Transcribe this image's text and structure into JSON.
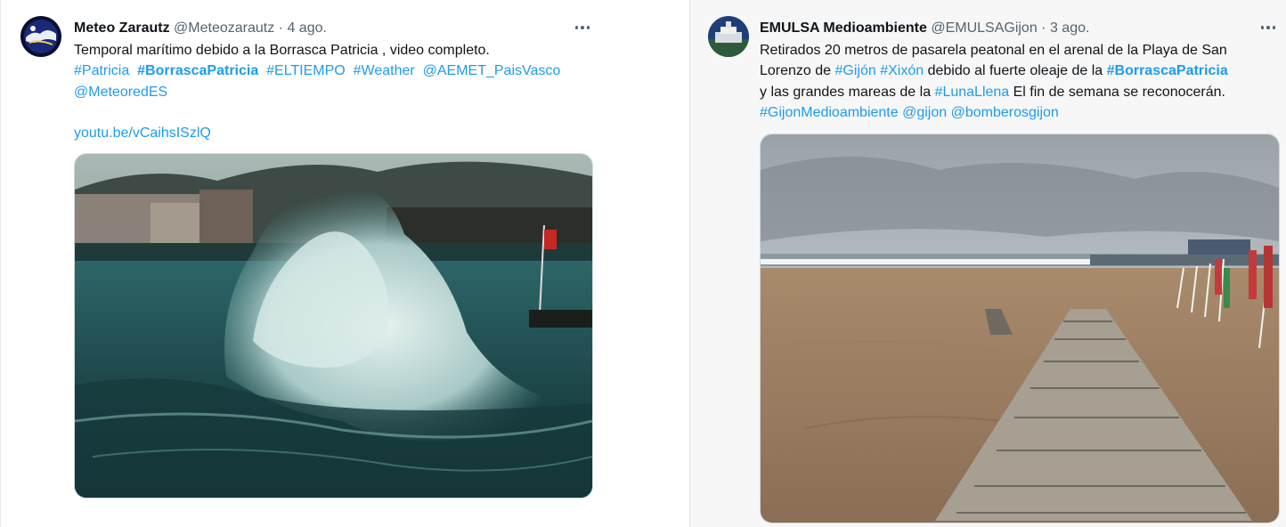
{
  "tweets": [
    {
      "name": "Meteo Zarautz",
      "handle": "@Meteozarautz",
      "separator": "·",
      "time": "4 ago.",
      "text_line1": "Temporal marítimo  debido a la Borrasca Patricia , video completo.",
      "hashtags": [
        "#Patricia",
        "#BorrascaPatricia",
        "#ELTIEMPO",
        "#Weather",
        "@AEMET_PaisVasco",
        "@MeteoredES"
      ],
      "link": "youtu.be/vCaihsISzlQ",
      "media_description_icon": "wave-crashing-photo"
    },
    {
      "name": "EMULSA Medioambiente",
      "handle": "@EMULSAGijon",
      "separator": "·",
      "time": "3 ago.",
      "line1": "Retirados 20 metros de pasarela peatonal en el arenal de la Playa de San",
      "line2_prefix": "Lorenzo de ",
      "tag_gijon": "#Gijón",
      "tag_xixon": "#Xixón",
      "line2_middle": " debido al fuerte oleaje de la ",
      "tag_borrasca": "#BorrascaPatricia",
      "line3_prefix": "y las grandes mareas de la ",
      "tag_luna": "#LunaLlena",
      "line3_suffix": " El fin de semana se reconocerán.",
      "tag_medioambiente": "#GijonMedioambiente",
      "mention_gijon": "@gijon",
      "mention_bomberos": "@bomberosgijon",
      "media_description_icon": "beach-boardwalk-photo"
    }
  ],
  "colors": {
    "link": "#1d9bf0",
    "text": "#0f1419",
    "muted": "#536471"
  },
  "icons": {
    "more": "more-dots-icon"
  }
}
